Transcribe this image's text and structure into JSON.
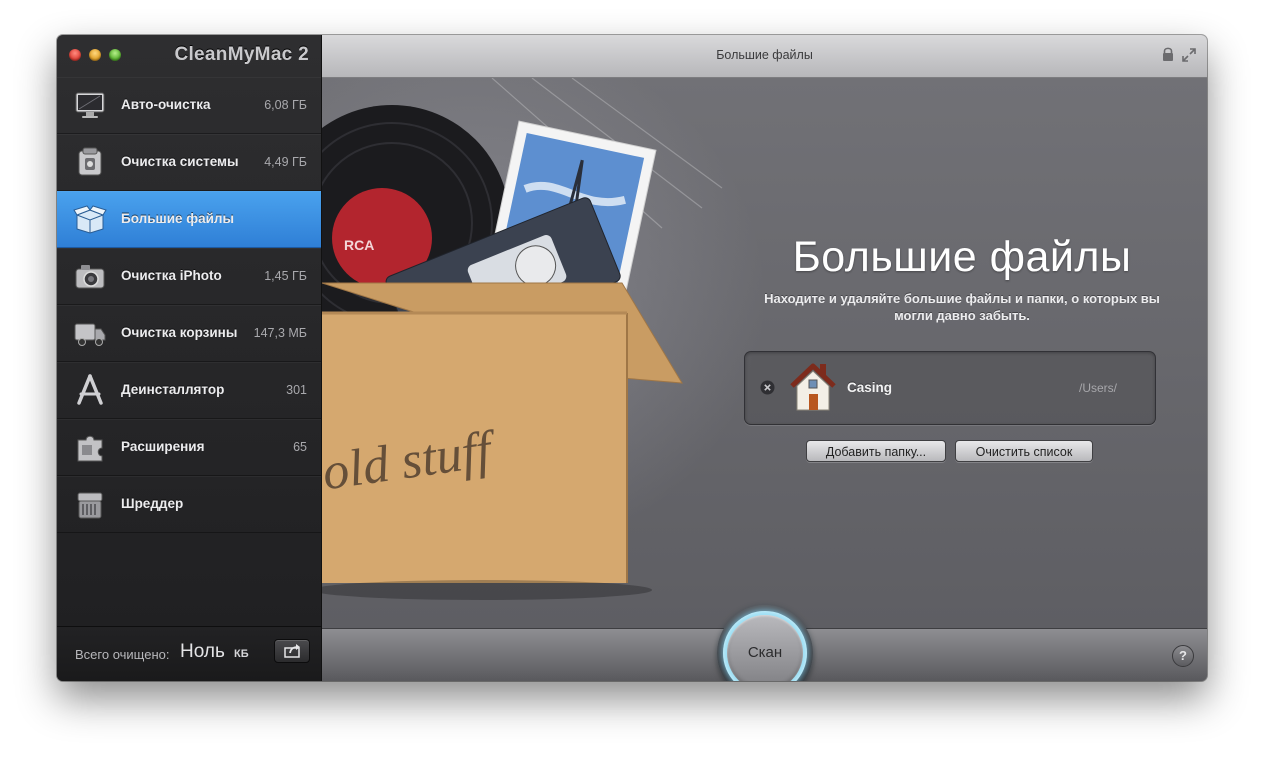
{
  "app": {
    "name": "CleanMyMac 2"
  },
  "window": {
    "title": "Большие файлы"
  },
  "sidebar": {
    "items": [
      {
        "label": "Авто-очистка",
        "value": "6,08 ГБ",
        "icon": "monitor-icon"
      },
      {
        "label": "Очистка системы",
        "value": "4,49 ГБ",
        "icon": "system-cleanup-icon"
      },
      {
        "label": "Большие файлы",
        "value": "",
        "icon": "box-icon",
        "active": true
      },
      {
        "label": "Очистка iPhoto",
        "value": "1,45 ГБ",
        "icon": "camera-icon"
      },
      {
        "label": "Очистка корзины",
        "value": "147,3 МБ",
        "icon": "garbage-truck-icon"
      },
      {
        "label": "Деинсталлятор",
        "value": "301",
        "icon": "app-store-icon"
      },
      {
        "label": "Расширения",
        "value": "65",
        "icon": "puzzle-icon"
      },
      {
        "label": "Шреддер",
        "value": "",
        "icon": "shredder-icon"
      }
    ],
    "footer": {
      "total_label": "Всего очищено:",
      "total_value": "Ноль",
      "total_unit": "КБ"
    }
  },
  "main": {
    "illustration_text": "old stuff",
    "hero_title": "Большие файлы",
    "hero_description": "Находите и удаляйте большие файлы и папки, о которых вы могли давно забыть.",
    "folders": [
      {
        "name": "Casing",
        "path": "/Users/"
      }
    ],
    "add_folder_label": "Добавить папку...",
    "clear_list_label": "Очистить список"
  },
  "bottombar": {
    "scan_label": "Скан",
    "help_label": "?"
  },
  "colors": {
    "accent": "#3d8fe3",
    "scan_glow": "#9fe0f5",
    "sidebar_bg": "#262628",
    "main_bg": "#66666a"
  }
}
